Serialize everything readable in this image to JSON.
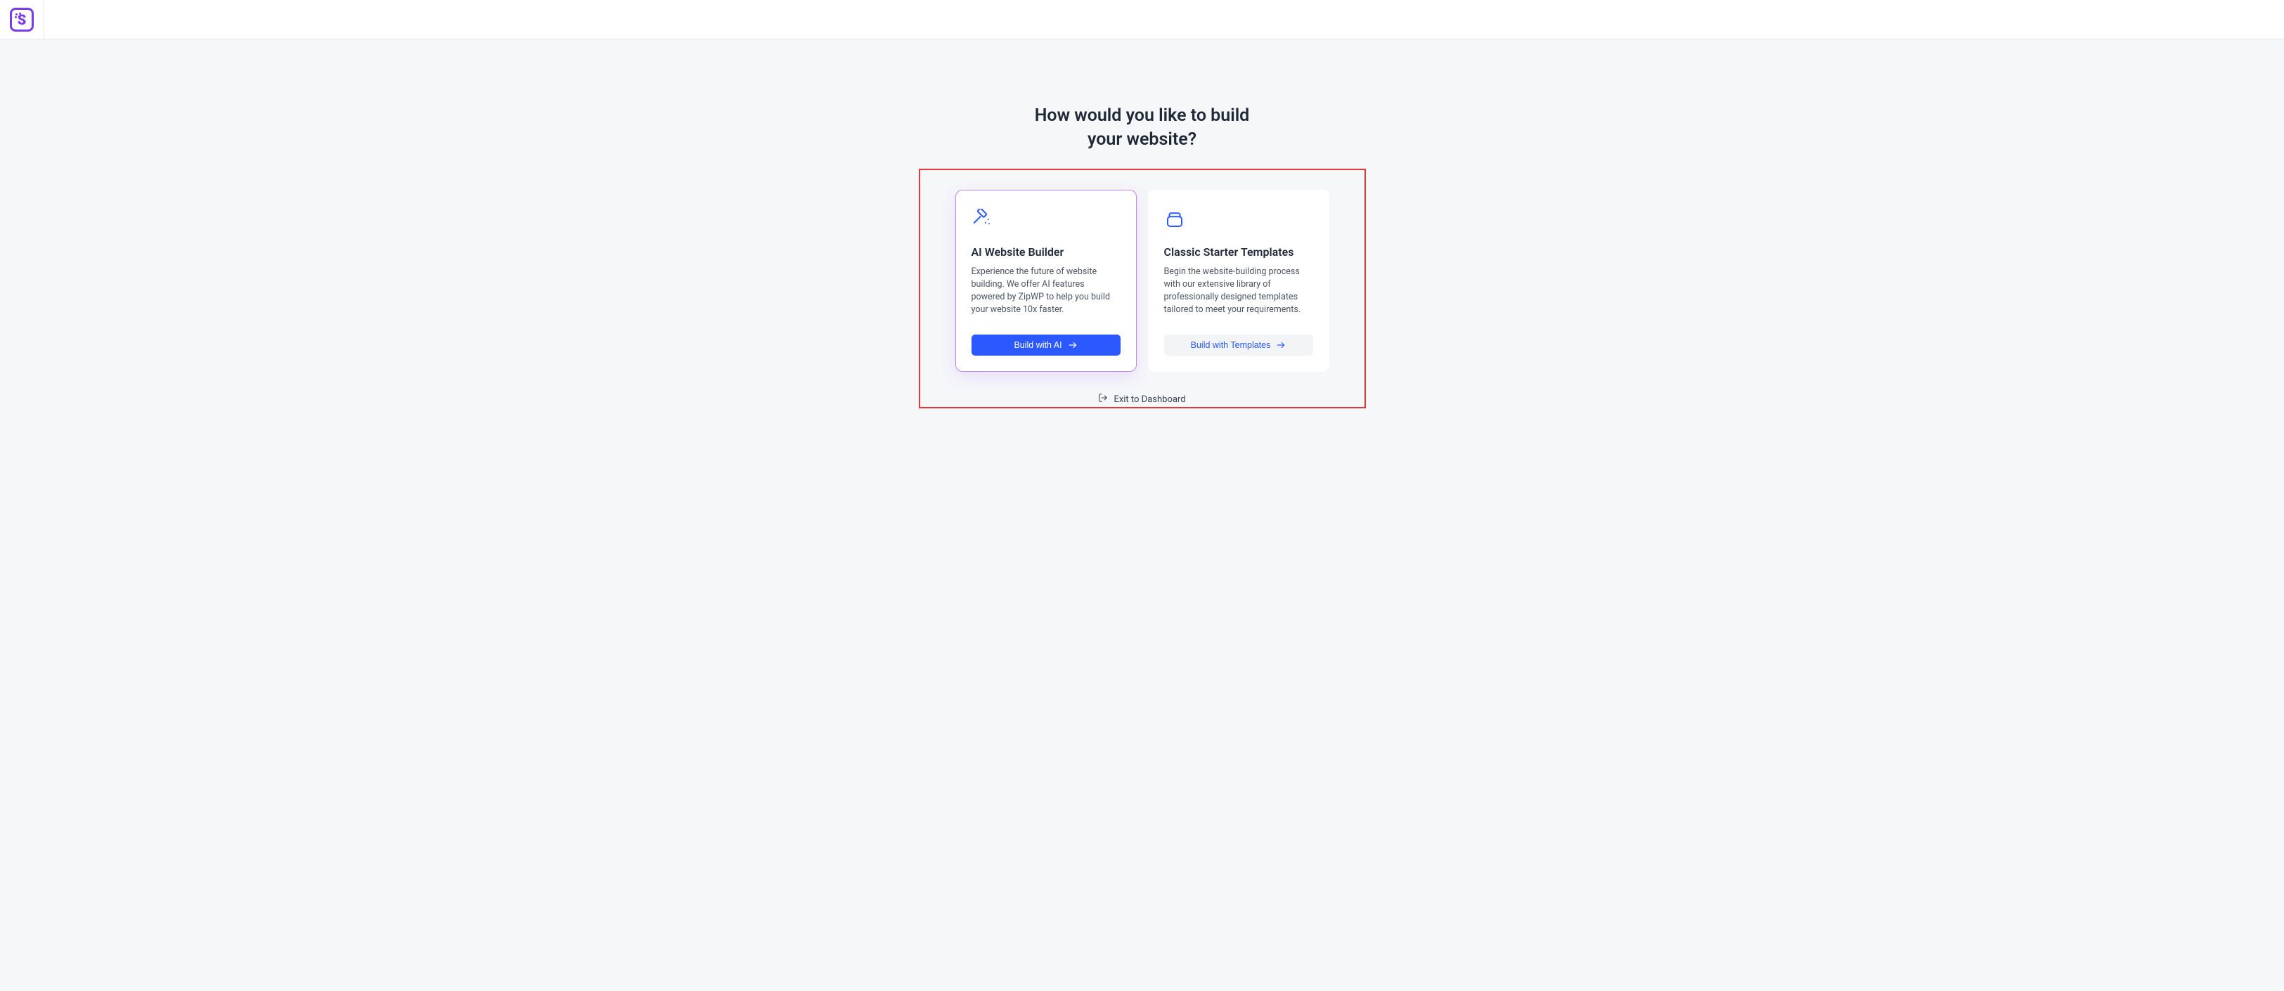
{
  "heading_line1": "How would you like to build",
  "heading_line2": "your website?",
  "cards": {
    "ai": {
      "title": "AI Website Builder",
      "desc": "Experience the future of website building. We offer AI features powered by ZipWP to help you build your website 10x faster.",
      "button": "Build with AI"
    },
    "classic": {
      "title": "Classic Starter Templates",
      "desc": "Begin the website-building process with our extensive library of professionally designed templates tailored to meet your requirements.",
      "button": "Build with Templates"
    }
  },
  "exit_label": "Exit to Dashboard",
  "colors": {
    "accent_blue": "#2b59ff",
    "accent_purple": "#7c3aed",
    "highlight_red": "#e53935"
  }
}
